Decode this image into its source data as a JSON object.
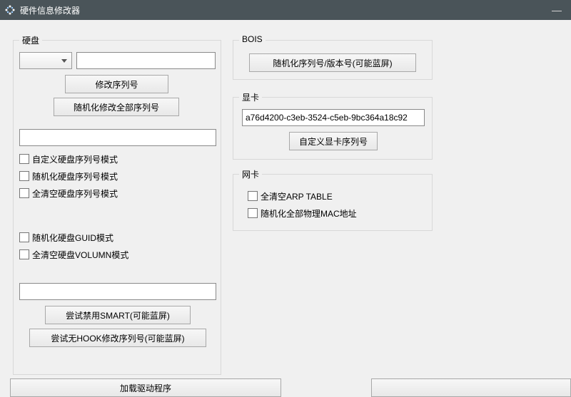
{
  "window": {
    "title": "硬件信息修改器",
    "minimize": "—"
  },
  "disk": {
    "group_label": "硬盘",
    "select_value": "",
    "serial_input": "",
    "btn_modify_serial": "修改序列号",
    "btn_random_all": "随机化修改全部序列号",
    "text1": "",
    "chk_custom_mode": "自定义硬盘序列号模式",
    "chk_random_mode": "随机化硬盘序列号模式",
    "chk_clear_mode": "全清空硬盘序列号模式",
    "chk_guid_mode": "随机化硬盘GUID模式",
    "chk_volumn_mode": "全清空硬盘VOLUMN模式",
    "text2": "",
    "btn_disable_smart": "尝试禁用SMART(可能蓝屏)",
    "btn_nohook": "尝试无HOOK修改序列号(可能蓝屏)"
  },
  "bios": {
    "group_label": "BOIS",
    "btn_random": "随机化序列号/版本号(可能蓝屏)"
  },
  "gpu": {
    "group_label": "显卡",
    "serial": "a76d4200-c3eb-3524-c5eb-9bc364a18c92",
    "btn_custom": "自定义显卡序列号"
  },
  "nic": {
    "group_label": "网卡",
    "chk_clear_arp": "全清空ARP TABLE",
    "chk_random_mac": "随机化全部物理MAC地址"
  },
  "bottom": {
    "btn_load_driver": "加载驱动程序"
  }
}
